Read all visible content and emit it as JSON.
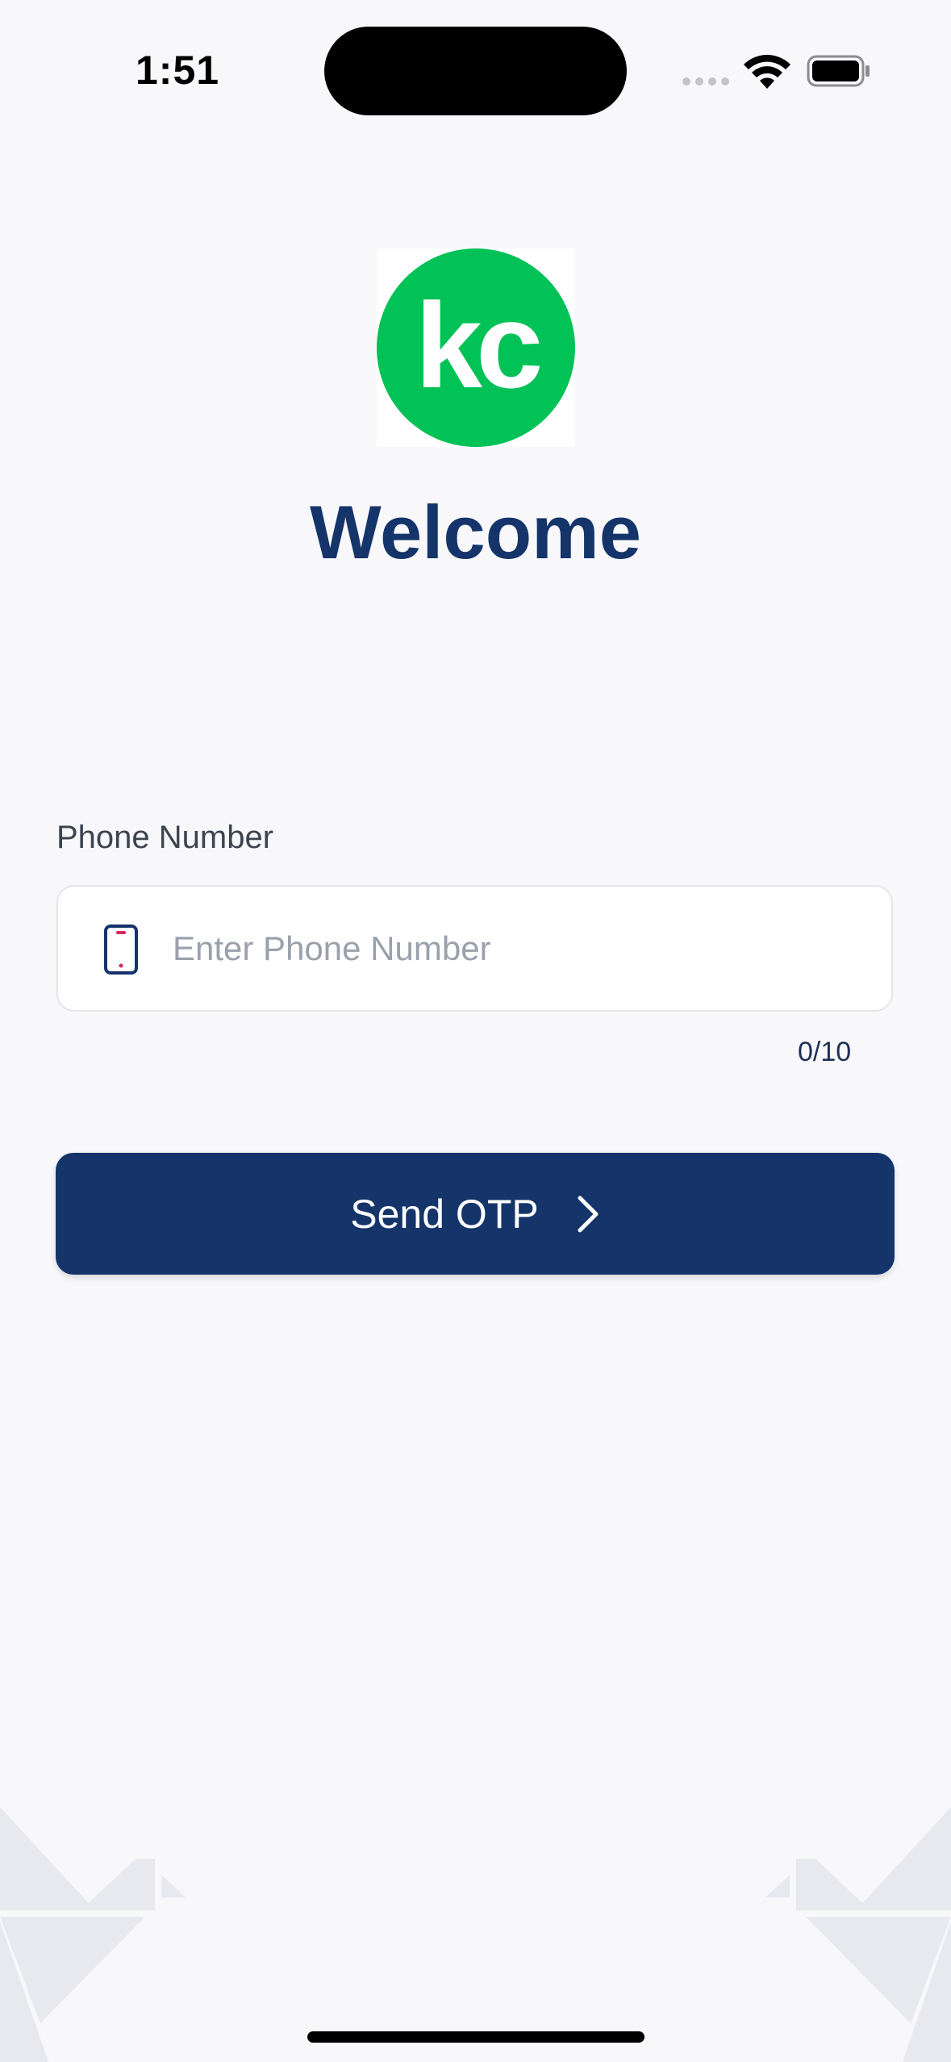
{
  "status_bar": {
    "time": "1:51"
  },
  "logo": {
    "text": "kc",
    "color": "#00c257"
  },
  "header": {
    "title": "Welcome"
  },
  "form": {
    "phone_label": "Phone Number",
    "phone_placeholder": "Enter Phone Number",
    "phone_value": "",
    "counter": "0/10",
    "icon": "mobile-phone-icon"
  },
  "actions": {
    "send_label": "Send OTP",
    "send_icon": "chevron-right-icon"
  },
  "colors": {
    "primary": "#15346a",
    "background": "#f8f8fa",
    "accent_green": "#00c257"
  }
}
